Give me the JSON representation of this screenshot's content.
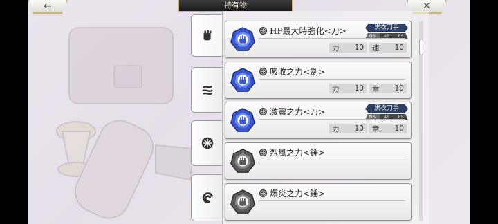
{
  "header": {
    "title": "持有物",
    "back_icon": "left-arrow-icon",
    "close_icon": "close-x-icon"
  },
  "categories": [
    {
      "name": "fist-icon",
      "active": true
    },
    {
      "name": "potion-icon",
      "active": false
    },
    {
      "name": "crest-icon",
      "active": false
    },
    {
      "name": "swirl-icon",
      "active": false
    }
  ],
  "items": [
    {
      "name": "HP最大時強化<刀>",
      "gem_color": "blue",
      "badge": {
        "label": "黒衣刀手",
        "tags": [
          "NS",
          "AS",
          "ES"
        ],
        "active_tag": "NS"
      },
      "stats": [
        {
          "label": "力",
          "value": "10"
        },
        {
          "label": "速",
          "value": "10"
        }
      ]
    },
    {
      "name": "吸收之力<劍>",
      "gem_color": "blue",
      "badge": null,
      "stats": [
        {
          "label": "力",
          "value": "10"
        },
        {
          "label": "幸",
          "value": "10"
        }
      ]
    },
    {
      "name": "激震之力<刀>",
      "gem_color": "blue",
      "badge": {
        "label": "黒衣刀手",
        "tags": [
          "NS",
          "AS",
          "ES"
        ],
        "active_tag": "NS"
      },
      "stats": [
        {
          "label": "力",
          "value": "10"
        },
        {
          "label": "幸",
          "value": "10"
        }
      ]
    },
    {
      "name": "烈風之力<錘>",
      "gem_color": "gray",
      "badge": null,
      "stats": []
    },
    {
      "name": "爆炎之力<錘>",
      "gem_color": "gray",
      "badge": null,
      "stats": []
    }
  ],
  "colors": {
    "accent_gold": "#c9b57a",
    "badge_navy": "#2c3f63",
    "gem_blue": "#3c57c9",
    "gem_gray": "#5a5a5a"
  }
}
